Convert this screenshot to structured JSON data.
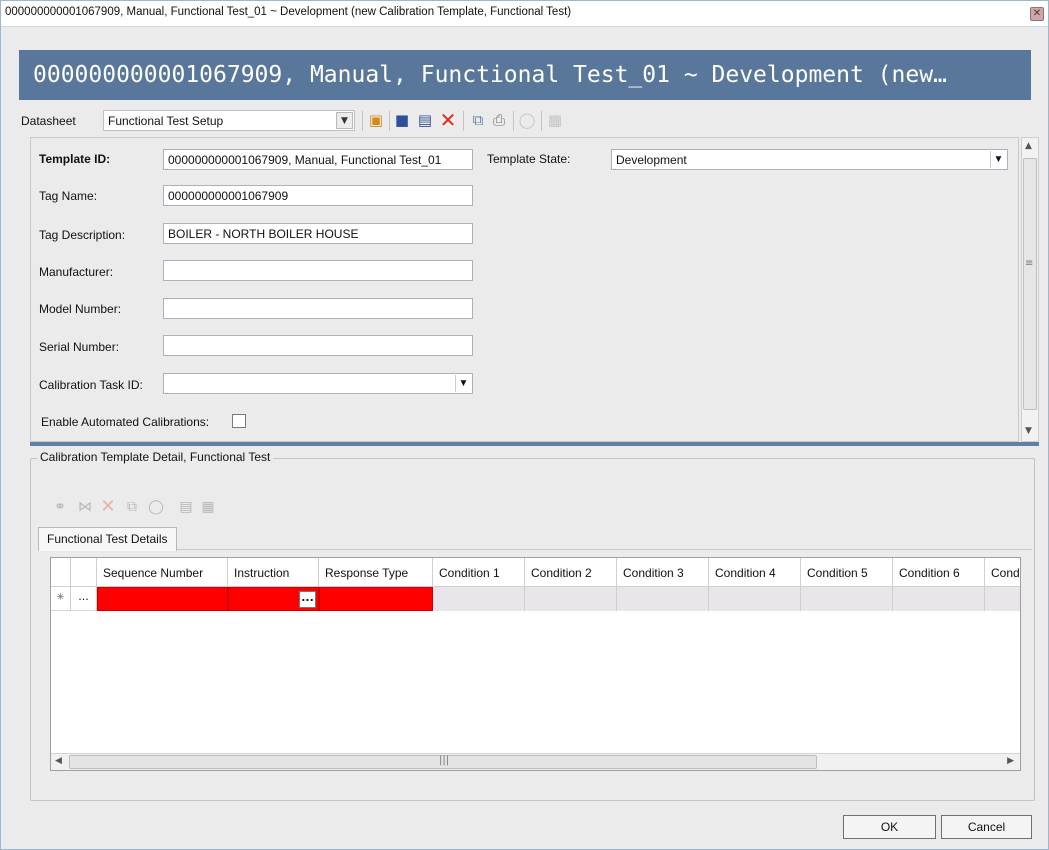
{
  "window": {
    "title": "000000000001067909, Manual, Functional Test_01 ~ Development (new Calibration Template, Functional Test)",
    "banner_title": "000000000001067909, Manual, Functional Test_01 ~ Development (new…"
  },
  "toolbar": {
    "datasheet_label": "Datasheet",
    "datasheet_value": "Functional Test Setup",
    "icons": [
      "new-icon",
      "save-icon",
      "save-new-icon",
      "delete-icon",
      "copy-icon",
      "print-icon",
      "clear-icon",
      "paste-icon"
    ]
  },
  "form": {
    "template_id_label": "Template ID:",
    "template_id_value": "000000000001067909, Manual, Functional Test_01",
    "template_state_label": "Template State:",
    "template_state_value": "Development",
    "tag_name_label": "Tag Name:",
    "tag_name_value": "000000000001067909",
    "tag_description_label": "Tag Description:",
    "tag_description_value": "BOILER - NORTH BOILER HOUSE",
    "manufacturer_label": "Manufacturer:",
    "manufacturer_value": "",
    "model_number_label": "Model Number:",
    "model_number_value": "",
    "serial_number_label": "Serial Number:",
    "serial_number_value": "",
    "calibration_task_label": "Calibration Task ID:",
    "calibration_task_value": "",
    "enable_automated_label": "Enable Automated Calibrations:",
    "enable_automated_checked": false
  },
  "detail": {
    "group_title": "Calibration Template Detail, Functional Test",
    "tab_label": "Functional Test Details",
    "columns": [
      "Sequence Number",
      "Instruction",
      "Response Type",
      "Condition 1",
      "Condition 2",
      "Condition 3",
      "Condition 4",
      "Condition 5",
      "Condition 6",
      "Cond"
    ],
    "new_row_marker": "✳",
    "new_row_ellipsis": "...",
    "cell_button": "..."
  },
  "footer": {
    "ok_label": "OK",
    "cancel_label": "Cancel"
  },
  "colors": {
    "banner": "#58779a",
    "required_cell": "#ff0000",
    "delete_icon": "#e02a1a"
  }
}
